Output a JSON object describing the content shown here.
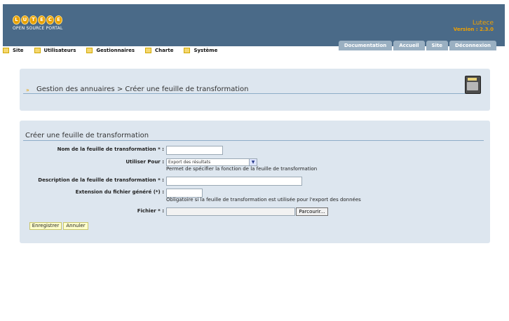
{
  "header": {
    "logo_letters": [
      "L",
      "U",
      "T",
      "E",
      "C",
      "E"
    ],
    "logo_subtitle": "OPEN SOURCE PORTAL",
    "app_name": "Lutece",
    "app_version": "Version : 2.3.0",
    "tabs": [
      {
        "label": "Documentation"
      },
      {
        "label": "Accueil"
      },
      {
        "label": "Site"
      },
      {
        "label": "Déconnexion"
      }
    ]
  },
  "menu": {
    "items": [
      {
        "label": "Site"
      },
      {
        "label": "Utilisateurs"
      },
      {
        "label": "Gestionnaires"
      },
      {
        "label": "Charte"
      },
      {
        "label": "Système"
      }
    ]
  },
  "breadcrumb": {
    "text": "Gestion des annuaires > Créer une feuille de transformation"
  },
  "form": {
    "title": "Créer une feuille de transformation",
    "name_label": "Nom de la feuille de transformation * :",
    "name_value": "",
    "use_for_label": "Utiliser Pour :",
    "use_for_selected": "Export des résultats",
    "use_for_hint": "Permet de spécifier la fonction de la feuille de transformation",
    "description_label": "Description de la feuille de transformation * :",
    "description_value": "",
    "extension_label": "Extension du fichier généré (*) :",
    "extension_value": "",
    "extension_hint": "Obligatoire si la feuille de transformation est utilisée pour l'export des données",
    "file_label": "Fichier * :",
    "browse_label": "Parcourir...",
    "save_label": "Enregistrer",
    "cancel_label": "Annuler"
  },
  "colors": {
    "header_bg": "#4a6a88",
    "accent": "#f0a000",
    "tab_bg": "#9ab0c2",
    "panel_bg": "#dde6ef"
  }
}
